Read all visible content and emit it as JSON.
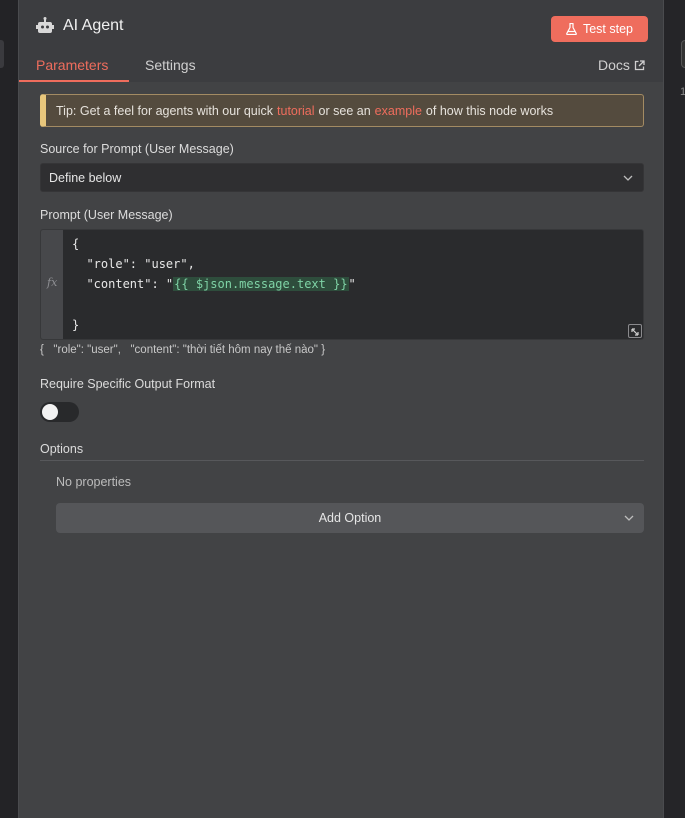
{
  "background": {
    "right_number": "1"
  },
  "header": {
    "title": "AI Agent",
    "test_step_label": "Test step",
    "tabs": [
      {
        "label": "Parameters",
        "active": true
      },
      {
        "label": "Settings",
        "active": false
      }
    ],
    "docs_label": "Docs"
  },
  "tip": {
    "prefix": "Tip: Get a feel for agents with our quick",
    "link1": "tutorial",
    "middle": "or see an",
    "link2": "example",
    "suffix": "of how this node works"
  },
  "source_prompt": {
    "label": "Source for Prompt (User Message)",
    "value": "Define below"
  },
  "prompt": {
    "label": "Prompt (User Message)",
    "lines": [
      "{",
      "  \"role\": \"user\",",
      "  \"content\": \"",
      "",
      "}"
    ],
    "content_expression": "{{ $json.message.text }}",
    "content_close": "\"",
    "preview": "{   \"role\": \"user\",   \"content\": \"thời tiết hôm nay thế nào\" }"
  },
  "output_format": {
    "label": "Require Specific Output Format",
    "enabled": false
  },
  "options": {
    "label": "Options",
    "empty_text": "No properties",
    "add_label": "Add Option"
  },
  "colors": {
    "accent": "#ef6d5d",
    "tip_border": "#e8c77c",
    "expression_text": "#7fd3a6"
  }
}
